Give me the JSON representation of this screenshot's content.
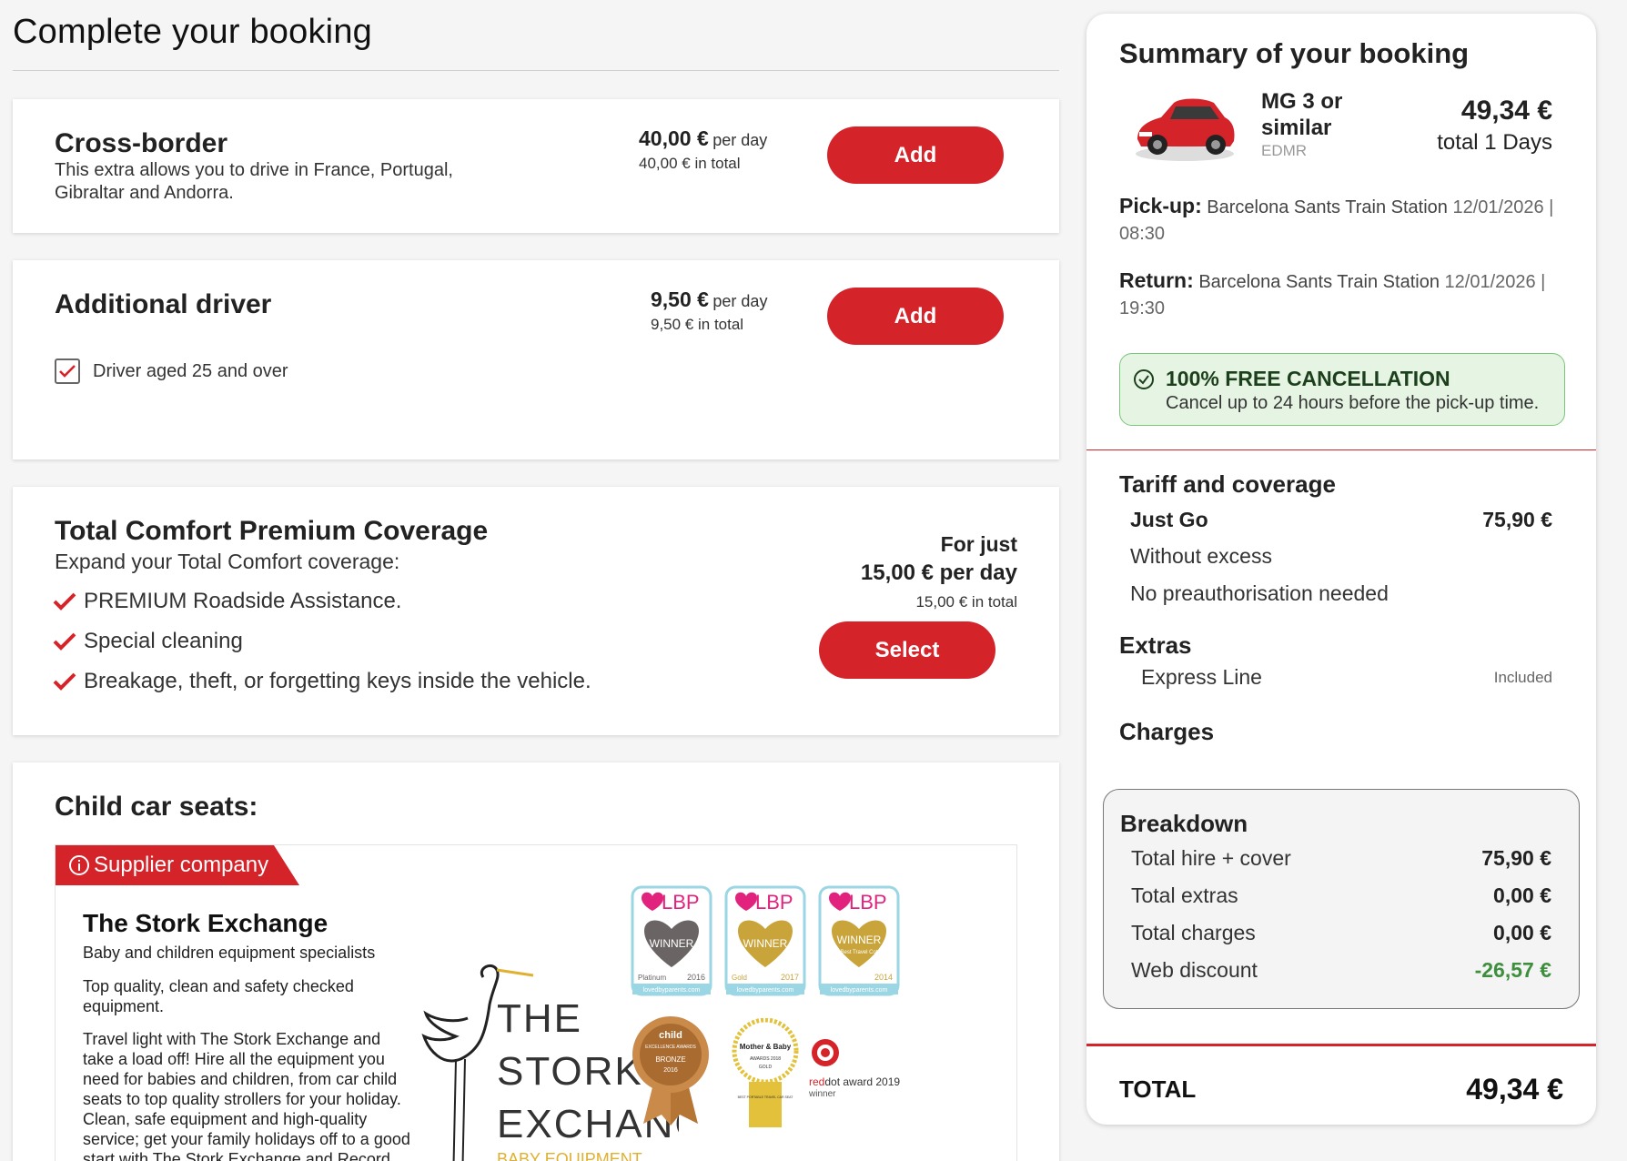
{
  "page": {
    "title": "Complete your booking"
  },
  "cross_border": {
    "title": "Cross-border",
    "desc": "This extra allows you to drive in France, Portugal, Gibraltar and Andorra.",
    "price": "40,00 €",
    "per": "per day",
    "total": "40,00 € in total",
    "button": "Add"
  },
  "additional_driver": {
    "title": "Additional driver",
    "price": "9,50 €",
    "per": "per day",
    "total": "9,50 € in total",
    "button": "Add",
    "checkbox_label": "Driver aged 25 and over",
    "checkbox_checked": true
  },
  "premium": {
    "title": "Total Comfort Premium Coverage",
    "desc": "Expand your Total Comfort coverage:",
    "features": [
      "PREMIUM Roadside Assistance.",
      "Special cleaning",
      "Breakage, theft, or forgetting keys inside the vehicle."
    ],
    "for_just": "For just",
    "price_line": "15,00 € per day",
    "total": "15,00 € in total",
    "button": "Select"
  },
  "child_seats": {
    "title": "Child car seats:",
    "supplier_tag": "Supplier company",
    "name": "The Stork Exchange",
    "subtitle": "Baby and children equipment specialists",
    "p1": "Top quality, clean and safety checked equipment.",
    "p2": "Travel light with The Stork Exchange and take a load off! Hire all the equipment you need for babies and children, from car child seats to top quality strollers for your holiday. Clean, safe equipment and high-quality service; get your family holidays off to a good start with The Stork Exchange and Record go.",
    "logo_lines": [
      "THE",
      "STORK",
      "EXCHANGE",
      "BABY EQUIPMENT"
    ],
    "awards": [
      {
        "brand": "LBP",
        "label": "WINNER",
        "tier": "Platinum",
        "year": "2016",
        "site": "lovedbyparents.com"
      },
      {
        "brand": "LBP",
        "label": "WINNER",
        "tier": "Gold",
        "year": "2017",
        "site": "lovedbyparents.com"
      },
      {
        "brand": "LBP",
        "label": "WINNER",
        "tier": "Best Travel Cot",
        "year": "2014",
        "site": "lovedbyparents.com"
      }
    ],
    "medal_child": {
      "brand": "child",
      "line1": "EXCELLENCE AWARDS",
      "tier": "BRONZE",
      "year": "2016"
    },
    "medal_mother": {
      "brand": "Mother & Baby",
      "line1": "AWARDS 2018",
      "tier": "GOLD",
      "ribbon": "BEST PORTABLE TRAVEL CAR SEAT"
    },
    "reddot": {
      "brand_red": "red",
      "brand_rest": "dot award 2019",
      "label": "winner"
    }
  },
  "summary": {
    "title": "Summary of your booking",
    "car_name": "MG 3 or similar",
    "car_code": "EDMR",
    "car_price": "49,34 €",
    "car_days": "total 1 Days",
    "pickup_label": "Pick-up:",
    "pickup_place": "Barcelona Sants Train Station",
    "pickup_time": "12/01/2026 | 08:30",
    "return_label": "Return:",
    "return_place": "Barcelona Sants Train Station",
    "return_time": "12/01/2026 | 19:30",
    "cancel_title": "100% FREE CANCELLATION",
    "cancel_sub": "Cancel up to 24 hours before the pick-up time.",
    "tariff_title": "Tariff and coverage",
    "tariff_name": "Just Go",
    "tariff_price": "75,90 €",
    "tariff_f1": "Without excess",
    "tariff_f2": "No preauthorisation needed",
    "extras_title": "Extras",
    "extra_name": "Express Line",
    "extra_status": "Included",
    "charges_title": "Charges",
    "breakdown_title": "Breakdown",
    "breakdown": [
      {
        "label": "Total hire + cover",
        "value": "75,90 €"
      },
      {
        "label": "Total extras",
        "value": "0,00 €"
      },
      {
        "label": "Total charges",
        "value": "0,00 €"
      },
      {
        "label": "Web discount",
        "value": "-26,57 €"
      }
    ],
    "total_label": "TOTAL",
    "total_value": "49,34 €"
  },
  "colors": {
    "accent": "#d5232a",
    "success_bg": "#e6f5e3",
    "discount": "#3e8e3e"
  }
}
